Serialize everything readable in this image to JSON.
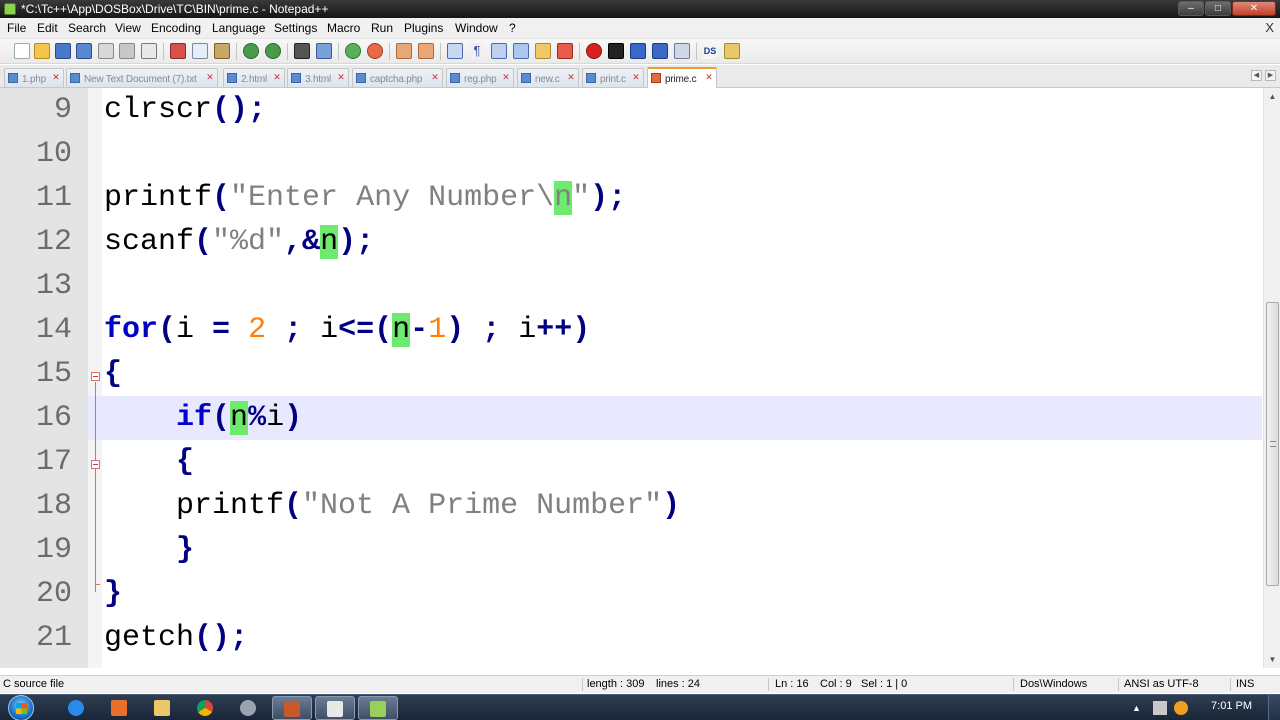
{
  "window": {
    "title": "*C:\\Tc++\\App\\DOSBox\\Drive\\TC\\BIN\\prime.c - Notepad++",
    "controls": [
      "minimize",
      "maximize",
      "close"
    ]
  },
  "menubar": {
    "items": [
      "File",
      "Edit",
      "Search",
      "Encoding",
      "Language",
      "Settings",
      "Macro",
      "Run",
      "Plugins",
      "Window",
      "?"
    ],
    "close_label": "X"
  },
  "tabs": [
    {
      "label": "1.php",
      "active": false
    },
    {
      "label": "New Text Document (7).txt",
      "active": false
    },
    {
      "label": "2.html",
      "active": false
    },
    {
      "label": "3.html",
      "active": false
    },
    {
      "label": "captcha.php",
      "active": false
    },
    {
      "label": "reg.php",
      "active": false
    },
    {
      "label": "new.c",
      "active": false
    },
    {
      "label": "print.c",
      "active": false
    },
    {
      "label": "prime.c",
      "active": true
    }
  ],
  "tab_arrows": {
    "left": "◀",
    "right": "▶"
  },
  "editor": {
    "current_line": 16,
    "highlight_color": "#6eea6e",
    "lines": [
      {
        "number": "9",
        "code": "clrscr();"
      },
      {
        "number": "10",
        "code": ""
      },
      {
        "number": "11",
        "code": "printf(\"Enter Any Number\\n\");"
      },
      {
        "number": "12",
        "code": "scanf(\"%d\",&n);"
      },
      {
        "number": "13",
        "code": ""
      },
      {
        "number": "14",
        "code": "for(i = 2 ; i<=(n-1) ; i++)"
      },
      {
        "number": "15",
        "code": "{"
      },
      {
        "number": "16",
        "code": "    if(n%i)"
      },
      {
        "number": "17",
        "code": "    {"
      },
      {
        "number": "18",
        "code": "    printf(\"Not A Prime Number\")"
      },
      {
        "number": "19",
        "code": "    }"
      },
      {
        "number": "20",
        "code": "}"
      },
      {
        "number": "21",
        "code": "getch();"
      }
    ]
  },
  "statusbar": {
    "file_type": "C source file",
    "length": "length : 309",
    "lines": "lines : 24",
    "ln": "Ln : 16",
    "col": "Col : 9",
    "sel": "Sel : 1 | 0",
    "eol": "Dos\\Windows",
    "encoding": "ANSI as UTF-8",
    "mode": "INS"
  },
  "taskbar": {
    "apps": [
      "internet-explorer",
      "app-orange",
      "file-explorer",
      "chrome",
      "app-gray",
      "dosbox",
      "window-app",
      "notepad++"
    ],
    "clock": "7:01 PM"
  },
  "colors": {
    "keyword": "#0000c8",
    "string": "#808080",
    "number": "#ff8000",
    "current_line_bg": "#e8e8ff",
    "active_tab_accent": "#f29a2e"
  }
}
